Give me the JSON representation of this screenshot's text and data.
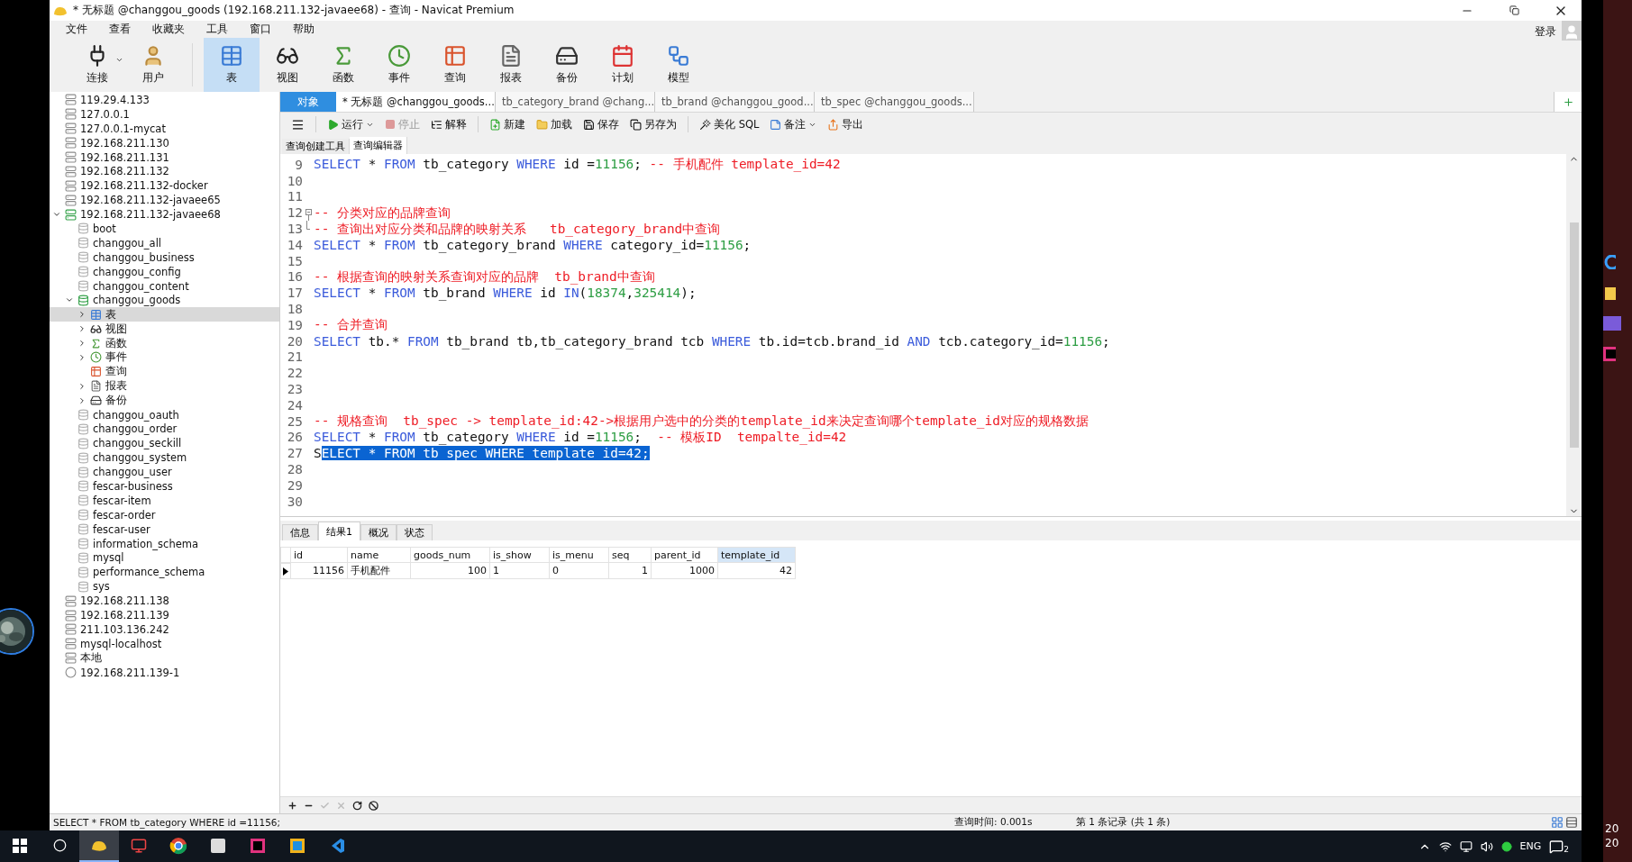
{
  "window": {
    "title": "* 无标题 @changgou_goods (192.168.211.132-javaee68) - 查询 - Navicat Premium"
  },
  "menu": [
    "文件",
    "查看",
    "收藏夹",
    "工具",
    "窗口",
    "帮助"
  ],
  "login": "登录",
  "toolbar_left": [
    {
      "label": "连接",
      "dropdown": true
    },
    {
      "label": "用户"
    }
  ],
  "toolbar_objects": [
    {
      "label": "表",
      "selected": true
    },
    {
      "label": "视图",
      "selected": false
    },
    {
      "label": "函数",
      "selected": false
    },
    {
      "label": "事件",
      "selected": false
    },
    {
      "label": "查询",
      "selected": false
    },
    {
      "label": "报表",
      "selected": false
    },
    {
      "label": "备份",
      "selected": false
    },
    {
      "label": "计划",
      "selected": false
    },
    {
      "label": "模型",
      "selected": false
    }
  ],
  "sidebar": {
    "tree": [
      {
        "label": "119.29.4.133",
        "kind": "connection",
        "selected": false
      },
      {
        "label": "127.0.0.1",
        "kind": "connection",
        "selected": false
      },
      {
        "label": "127.0.0.1-mycat",
        "kind": "connection",
        "selected": false
      },
      {
        "label": "192.168.211.130",
        "kind": "connection",
        "selected": false
      },
      {
        "label": "192.168.211.131",
        "kind": "connection",
        "selected": false
      },
      {
        "label": "192.168.211.132",
        "kind": "connection",
        "selected": false
      },
      {
        "label": "192.168.211.132-docker",
        "kind": "connection",
        "selected": false
      },
      {
        "label": "192.168.211.132-javaee65",
        "kind": "connection",
        "selected": false
      },
      {
        "label": "192.168.211.132-javaee68",
        "kind": "connection",
        "open": true,
        "expanded": true,
        "selected": false,
        "children": [
          {
            "label": "boot",
            "kind": "database",
            "selected": false
          },
          {
            "label": "changgou_all",
            "kind": "database",
            "selected": false
          },
          {
            "label": "changgou_business",
            "kind": "database",
            "selected": false
          },
          {
            "label": "changgou_config",
            "kind": "database",
            "selected": false
          },
          {
            "label": "changgou_content",
            "kind": "database",
            "selected": false
          },
          {
            "label": "changgou_goods",
            "kind": "database",
            "open": true,
            "expanded": true,
            "selected": false,
            "children": [
              {
                "label": "表",
                "kind": "table",
                "expanded": false,
                "selected": true
              },
              {
                "label": "视图",
                "kind": "view",
                "expanded": false,
                "selected": false
              },
              {
                "label": "函数",
                "kind": "function",
                "expanded": false,
                "selected": false
              },
              {
                "label": "事件",
                "kind": "event",
                "expanded": false,
                "selected": false
              },
              {
                "label": "查询",
                "kind": "query",
                "selected": false
              },
              {
                "label": "报表",
                "kind": "report",
                "expanded": false,
                "selected": false
              },
              {
                "label": "备份",
                "kind": "backup",
                "expanded": false,
                "selected": false
              }
            ]
          },
          {
            "label": "changgou_oauth",
            "kind": "database",
            "selected": false
          },
          {
            "label": "changgou_order",
            "kind": "database",
            "selected": false
          },
          {
            "label": "changgou_seckill",
            "kind": "database",
            "selected": false
          },
          {
            "label": "changgou_system",
            "kind": "database",
            "selected": false
          },
          {
            "label": "changgou_user",
            "kind": "database",
            "selected": false
          },
          {
            "label": "fescar-business",
            "kind": "database",
            "selected": false
          },
          {
            "label": "fescar-item",
            "kind": "database",
            "selected": false
          },
          {
            "label": "fescar-order",
            "kind": "database",
            "selected": false
          },
          {
            "label": "fescar-user",
            "kind": "database",
            "selected": false
          },
          {
            "label": "information_schema",
            "kind": "database",
            "selected": false
          },
          {
            "label": "mysql",
            "kind": "database",
            "selected": false
          },
          {
            "label": "performance_schema",
            "kind": "database",
            "selected": false
          },
          {
            "label": "sys",
            "kind": "database",
            "selected": false
          }
        ]
      },
      {
        "label": "192.168.211.138",
        "kind": "connection",
        "selected": false
      },
      {
        "label": "192.168.211.139",
        "kind": "connection",
        "selected": false
      },
      {
        "label": "211.103.136.242",
        "kind": "connection",
        "selected": false
      },
      {
        "label": "mysql-localhost",
        "kind": "connection",
        "selected": false
      },
      {
        "label": "本地",
        "kind": "connection",
        "selected": false
      },
      {
        "label": "192.168.211.139-1",
        "kind": "other",
        "selected": false
      }
    ]
  },
  "object_tab": "对象",
  "tabs": [
    {
      "label": "* 无标题 @changgou_goods...",
      "selected": true
    },
    {
      "label": "tb_category_brand @chang...",
      "selected": false
    },
    {
      "label": "tb_brand @changgou_good...",
      "selected": false
    },
    {
      "label": "tb_spec @changgou_goods...",
      "selected": false
    }
  ],
  "editor_toolbar": [
    {
      "label": "运行",
      "dropdown": true,
      "disabled": false
    },
    {
      "label": "停止",
      "disabled": true
    },
    {
      "label": "解释",
      "disabled": false
    },
    {
      "label": "新建",
      "disabled": false
    },
    {
      "label": "加载",
      "disabled": false
    },
    {
      "label": "保存",
      "disabled": false
    },
    {
      "label": "另存为",
      "disabled": false
    },
    {
      "label": "美化 SQL",
      "disabled": false
    },
    {
      "label": "备注",
      "dropdown": true,
      "disabled": false
    },
    {
      "label": "导出",
      "disabled": false
    }
  ],
  "sub_tabs": [
    {
      "label": "查询创建工具",
      "selected": false
    },
    {
      "label": "查询编辑器",
      "selected": true
    }
  ],
  "editor": {
    "lines": [
      {
        "number": "9",
        "kind": "code",
        "tokens": [
          {
            "kind": "keyword",
            "text": "SELECT"
          },
          {
            "kind": "plain",
            "text": " * "
          },
          {
            "kind": "keyword",
            "text": "FROM"
          },
          {
            "kind": "plain",
            "text": " tb_category "
          },
          {
            "kind": "keyword",
            "text": "WHERE"
          },
          {
            "kind": "plain",
            "text": " id ="
          },
          {
            "kind": "number",
            "text": "11156"
          },
          {
            "kind": "plain",
            "text": "; "
          },
          {
            "kind": "comment",
            "text": "-- 手机配件 template_id=42"
          }
        ]
      },
      {
        "number": "10",
        "kind": "code"
      },
      {
        "number": "11",
        "kind": "code"
      },
      {
        "number": "12",
        "kind": "fold_start",
        "tokens": [
          {
            "kind": "comment",
            "text": "-- 分类对应的品牌查询"
          }
        ]
      },
      {
        "number": "13",
        "kind": "fold_end",
        "tokens": [
          {
            "kind": "comment",
            "text": "-- 查询出对应分类和品牌的映射关系   tb_category_brand中查询"
          }
        ]
      },
      {
        "number": "14",
        "kind": "code",
        "tokens": [
          {
            "kind": "keyword",
            "text": "SELECT"
          },
          {
            "kind": "plain",
            "text": " * "
          },
          {
            "kind": "keyword",
            "text": "FROM"
          },
          {
            "kind": "plain",
            "text": " tb_category_brand "
          },
          {
            "kind": "keyword",
            "text": "WHERE"
          },
          {
            "kind": "plain",
            "text": " category_id="
          },
          {
            "kind": "number",
            "text": "11156"
          },
          {
            "kind": "plain",
            "text": ";"
          }
        ]
      },
      {
        "number": "15",
        "kind": "code"
      },
      {
        "number": "16",
        "kind": "code",
        "tokens": [
          {
            "kind": "comment",
            "text": "-- 根据查询的映射关系查询对应的品牌  tb_brand中查询"
          }
        ]
      },
      {
        "number": "17",
        "kind": "code",
        "tokens": [
          {
            "kind": "keyword",
            "text": "SELECT"
          },
          {
            "kind": "plain",
            "text": " * "
          },
          {
            "kind": "keyword",
            "text": "FROM"
          },
          {
            "kind": "plain",
            "text": " tb_brand "
          },
          {
            "kind": "keyword",
            "text": "WHERE"
          },
          {
            "kind": "plain",
            "text": " id "
          },
          {
            "kind": "keyword",
            "text": "IN"
          },
          {
            "kind": "plain",
            "text": "("
          },
          {
            "kind": "number",
            "text": "18374"
          },
          {
            "kind": "plain",
            "text": ","
          },
          {
            "kind": "number",
            "text": "325414"
          },
          {
            "kind": "plain",
            "text": ");"
          }
        ]
      },
      {
        "number": "18",
        "kind": "code"
      },
      {
        "number": "19",
        "kind": "code",
        "tokens": [
          {
            "kind": "comment",
            "text": "-- 合并查询"
          }
        ]
      },
      {
        "number": "20",
        "kind": "code",
        "tokens": [
          {
            "kind": "keyword",
            "text": "SELECT"
          },
          {
            "kind": "plain",
            "text": " tb.* "
          },
          {
            "kind": "keyword",
            "text": "FROM"
          },
          {
            "kind": "plain",
            "text": " tb_brand tb,tb_category_brand tcb "
          },
          {
            "kind": "keyword",
            "text": "WHERE"
          },
          {
            "kind": "plain",
            "text": " tb.id=tcb.brand_id "
          },
          {
            "kind": "keyword",
            "text": "AND"
          },
          {
            "kind": "plain",
            "text": " tcb.category_id="
          },
          {
            "kind": "number",
            "text": "11156"
          },
          {
            "kind": "plain",
            "text": ";"
          }
        ]
      },
      {
        "number": "21",
        "kind": "code"
      },
      {
        "number": "22",
        "kind": "code"
      },
      {
        "number": "23",
        "kind": "code"
      },
      {
        "number": "24",
        "kind": "code"
      },
      {
        "number": "25",
        "kind": "code",
        "tokens": [
          {
            "kind": "comment",
            "text": "-- 规格查询  tb_spec -> template_id:42->根据用户选中的分类的template_id来决定查询哪个template_id对应的规格数据"
          }
        ]
      },
      {
        "number": "26",
        "kind": "code",
        "tokens": [
          {
            "kind": "keyword",
            "text": "SELECT"
          },
          {
            "kind": "plain",
            "text": " * "
          },
          {
            "kind": "keyword",
            "text": "FROM"
          },
          {
            "kind": "plain",
            "text": " tb_category "
          },
          {
            "kind": "keyword",
            "text": "WHERE"
          },
          {
            "kind": "plain",
            "text": " id ="
          },
          {
            "kind": "number",
            "text": "11156"
          },
          {
            "kind": "plain",
            "text": ";  "
          },
          {
            "kind": "comment",
            "text": "-- 模板ID  tempalte_id=42"
          }
        ]
      },
      {
        "number": "27",
        "kind": "code",
        "tokens": [
          {
            "kind": "plain",
            "text": "S"
          },
          {
            "kind": "selected",
            "text": "ELECT * FROM tb_spec WHERE template_id=42;"
          }
        ]
      },
      {
        "number": "28",
        "kind": "code"
      },
      {
        "number": "29",
        "kind": "code"
      },
      {
        "number": "30",
        "kind": "code"
      }
    ]
  },
  "result_tabs": [
    {
      "label": "信息",
      "selected": false
    },
    {
      "label": "结果1",
      "selected": true
    },
    {
      "label": "概况",
      "selected": false
    },
    {
      "label": "状态",
      "selected": false
    }
  ],
  "grid": {
    "columns": [
      {
        "label": "id",
        "kind": "number",
        "selected": false
      },
      {
        "label": "name",
        "kind": "text",
        "selected": false
      },
      {
        "label": "goods_num",
        "kind": "number",
        "selected": false
      },
      {
        "label": "is_show",
        "kind": "text",
        "selected": false
      },
      {
        "label": "is_menu",
        "kind": "text",
        "selected": false
      },
      {
        "label": "seq",
        "kind": "number",
        "selected": false
      },
      {
        "label": "parent_id",
        "kind": "number",
        "selected": false
      },
      {
        "label": "template_id",
        "kind": "number",
        "selected": true
      }
    ],
    "rows": [
      [
        "11156",
        "手机配件",
        "100",
        "1",
        "0",
        "1",
        "1000",
        "42"
      ]
    ]
  },
  "grid_actions": [
    {
      "disabled": false
    },
    {
      "disabled": false
    },
    {
      "disabled": true
    },
    {
      "disabled": true
    },
    {
      "disabled": false
    },
    {
      "disabled": false
    }
  ],
  "status_bar": {
    "sql": "SELECT * FROM tb_category WHERE id =11156;",
    "time": "查询时间: 0.001s",
    "records": "第 1 条记录 (共 1 条)"
  },
  "taskbar": {
    "apps": [
      {
        "selected": true
      },
      {
        "selected": false
      },
      {
        "selected": false
      },
      {
        "selected": false
      },
      {
        "selected": false
      },
      {
        "selected": false
      },
      {
        "selected": false
      }
    ],
    "language": "ENG",
    "notifications": "2"
  },
  "desktop_clock": [
    "20",
    "20"
  ]
}
